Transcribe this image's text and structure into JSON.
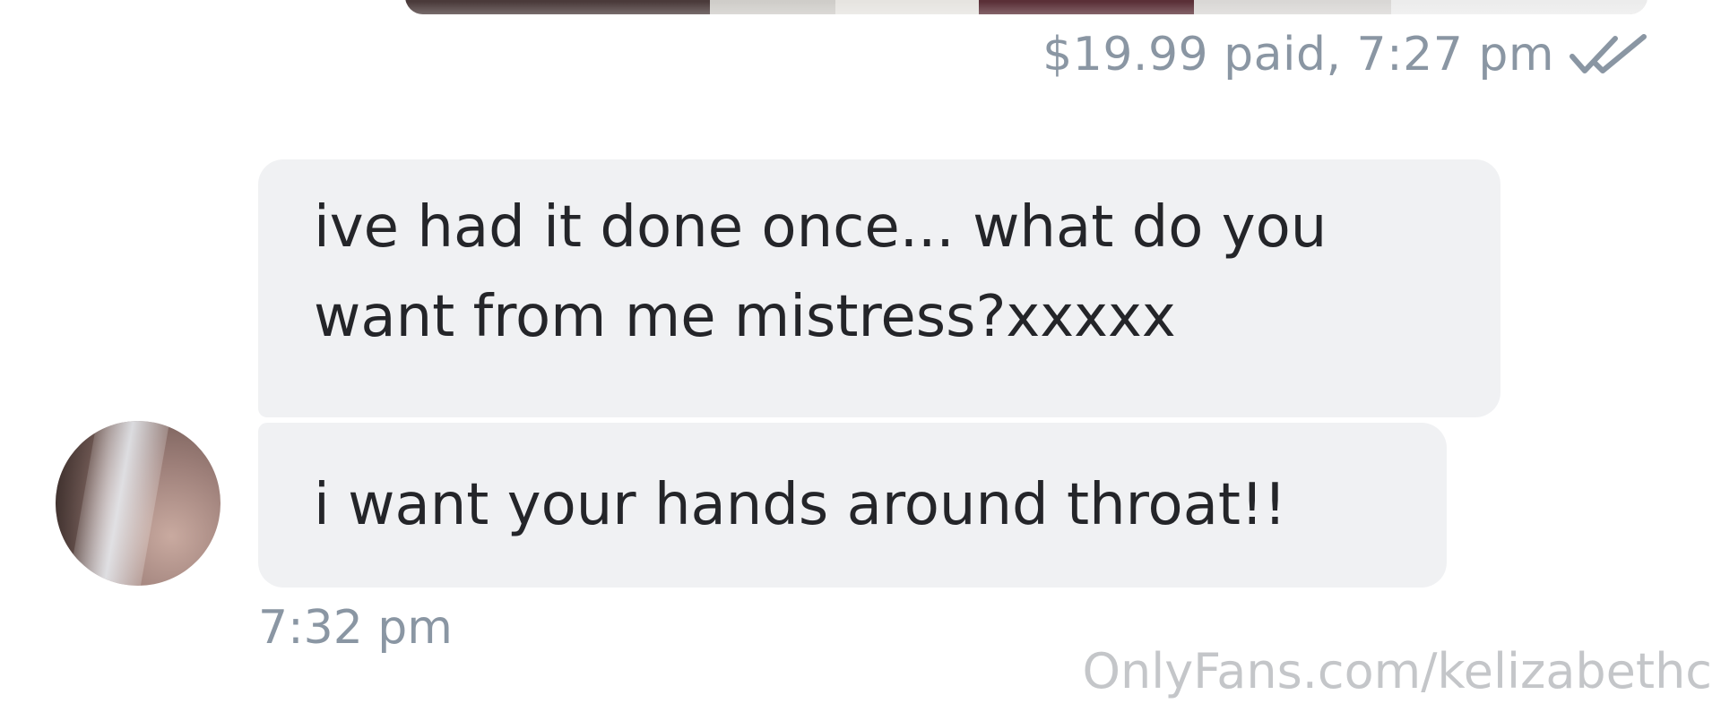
{
  "sent_message": {
    "meta": "$19.99 paid, 7:27 pm",
    "status_icon": "double-check-icon",
    "status_color": "#8a96a3"
  },
  "received_messages": {
    "message_1": {
      "line_1": "ive had it done once... what do you",
      "line_2": "want from me mistress?xxxxx"
    },
    "message_2": {
      "line_1": "i want your hands around throat!!"
    },
    "time": "7:32 pm",
    "avatar": "user-avatar"
  },
  "watermark": "OnlyFans.com/kelizabethc",
  "colors": {
    "bubble_background": "#f0f1f3",
    "message_text": "#242529",
    "meta_text": "#8a96a3",
    "watermark_text": "#c4c6c9"
  }
}
